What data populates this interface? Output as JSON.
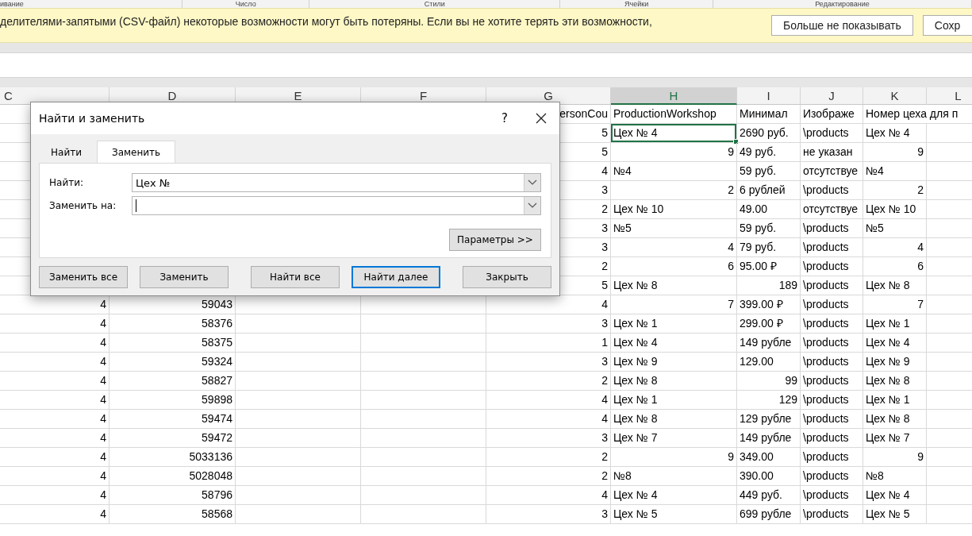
{
  "ribbon_groups": [
    "ивание",
    "Число",
    "Стили",
    "Ячейки",
    "Редактирование"
  ],
  "message_bar": {
    "text": "делителями-запятыми (CSV-файл) некоторые возможности могут быть потеряны. Если вы не хотите терять эти возможности,",
    "buttons": [
      "Больше не показывать",
      "Сохр"
    ]
  },
  "table": {
    "columns": [
      {
        "letter": "C",
        "selected": false
      },
      {
        "letter": "D",
        "selected": false
      },
      {
        "letter": "E",
        "selected": false
      },
      {
        "letter": "F",
        "selected": false
      },
      {
        "letter": "G",
        "selected": false
      },
      {
        "letter": "H",
        "selected": true
      },
      {
        "letter": "I",
        "selected": false
      },
      {
        "letter": "J",
        "selected": false
      },
      {
        "letter": "K",
        "selected": false
      },
      {
        "letter": "L",
        "selected": false
      }
    ],
    "rows": [
      {
        "G": "ersonCou",
        "H": "ProductionWorkshop",
        "I": "Минимал",
        "J": "Изображе",
        "K": "Номер цеха для п",
        "selected": false
      },
      {
        "G": "5",
        "H": "Цех № 4",
        "I": "2690 руб.",
        "J": "\\products",
        "K": "Цех № 4",
        "numeric": {
          "H": false,
          "I": false,
          "K": false
        },
        "selected": true
      },
      {
        "G": "5",
        "H": "9",
        "I": "49 руб.",
        "J": "не указан",
        "K": "9",
        "numeric": {
          "H": true,
          "I": false,
          "K": true
        },
        "selected": false
      },
      {
        "G": "4",
        "H": "№4",
        "I": "59 руб.",
        "J": "отсутствуе",
        "K": "№4",
        "numeric": {
          "H": false,
          "I": false,
          "K": false
        },
        "selected": false
      },
      {
        "G": "3",
        "H": "2",
        "I": "6 рублей",
        "J": "\\products",
        "K": "2",
        "numeric": {
          "H": true,
          "I": false,
          "K": true
        },
        "selected": false
      },
      {
        "G": "2",
        "H": "Цех № 10",
        "I": "49.00",
        "J": "отсутствуе",
        "K": "Цех № 10",
        "numeric": {
          "H": false,
          "I": false,
          "K": false
        },
        "selected": false
      },
      {
        "G": "3",
        "H": "№5",
        "I": "59 руб.",
        "J": "\\products",
        "K": "№5",
        "numeric": {
          "H": false,
          "I": false,
          "K": false
        },
        "selected": false
      },
      {
        "G": "3",
        "H": "4",
        "I": "79 руб.",
        "J": "\\products",
        "K": "4",
        "numeric": {
          "H": true,
          "I": false,
          "K": true
        },
        "selected": false
      },
      {
        "G": "2",
        "H": "6",
        "I": "95.00 ₽",
        "J": "\\products",
        "K": "6",
        "numeric": {
          "H": true,
          "I": false,
          "K": true
        },
        "selected": false
      },
      {
        "G": "5",
        "H": "Цех № 8",
        "I": "189",
        "J": "\\products",
        "K": "Цех № 8",
        "numeric": {
          "H": false,
          "I": true,
          "K": false
        },
        "selected": false
      },
      {
        "C": "4",
        "D": "59043",
        "G": "4",
        "H": "7",
        "I": "399.00 ₽",
        "J": "\\products",
        "K": "7",
        "numeric": {
          "H": true,
          "I": false,
          "K": true
        },
        "selected": false
      },
      {
        "C": "4",
        "D": "58376",
        "G": "3",
        "H": "Цех № 1",
        "I": "299.00 ₽",
        "J": "\\products",
        "K": "Цех № 1",
        "numeric": {
          "H": false,
          "I": false,
          "K": false
        },
        "selected": false
      },
      {
        "C": "4",
        "D": "58375",
        "G": "1",
        "H": "Цех № 4",
        "I": "149 рубле",
        "J": "\\products",
        "K": "Цех № 4",
        "numeric": {
          "H": false,
          "I": false,
          "K": false
        },
        "selected": false
      },
      {
        "C": "4",
        "D": "59324",
        "G": "3",
        "H": "Цех № 9",
        "I": "129.00",
        "J": "\\products",
        "K": "Цех № 9",
        "numeric": {
          "H": false,
          "I": false,
          "K": false
        },
        "selected": false
      },
      {
        "C": "4",
        "D": "58827",
        "G": "2",
        "H": "Цех № 8",
        "I": "99",
        "J": "\\products",
        "K": "Цех № 8",
        "numeric": {
          "H": false,
          "I": true,
          "K": false
        },
        "selected": false
      },
      {
        "C": "4",
        "D": "59898",
        "G": "4",
        "H": "Цех № 1",
        "I": "129",
        "J": "\\products",
        "K": "Цех № 1",
        "numeric": {
          "H": false,
          "I": true,
          "K": false
        },
        "selected": false
      },
      {
        "C": "4",
        "D": "59474",
        "G": "4",
        "H": "Цех № 8",
        "I": "129 рубле",
        "J": "\\products",
        "K": "Цех № 8",
        "numeric": {
          "H": false,
          "I": false,
          "K": false
        },
        "selected": false
      },
      {
        "C": "4",
        "D": "59472",
        "G": "3",
        "H": "Цех № 7",
        "I": "149 рубле",
        "J": "\\products",
        "K": "Цех № 7",
        "numeric": {
          "H": false,
          "I": false,
          "K": false
        },
        "selected": false
      },
      {
        "C": "4",
        "D": "5033136",
        "G": "2",
        "H": "9",
        "I": "349.00",
        "J": "\\products",
        "K": "9",
        "numeric": {
          "H": true,
          "I": false,
          "K": true
        },
        "selected": false
      },
      {
        "C": "4",
        "D": "5028048",
        "G": "2",
        "H": "№8",
        "I": "390.00",
        "J": "\\products",
        "K": "№8",
        "numeric": {
          "H": false,
          "I": false,
          "K": false
        },
        "selected": false
      },
      {
        "C": "4",
        "D": "58796",
        "G": "4",
        "H": "Цех № 4",
        "I": "449 руб.",
        "J": "\\products",
        "K": "Цех № 4",
        "numeric": {
          "H": false,
          "I": false,
          "K": false
        },
        "selected": false
      },
      {
        "C": "4",
        "D": "58568",
        "G": "3",
        "H": "Цех № 5",
        "I": "699 рубле",
        "J": "\\products",
        "K": "Цех № 5",
        "numeric": {
          "H": false,
          "I": false,
          "K": false
        },
        "selected": false
      }
    ]
  },
  "dialog": {
    "title": "Найти и заменить",
    "help": "?",
    "tabs": [
      {
        "label": "Найти",
        "selected": false
      },
      {
        "label": "Заменить",
        "selected": true
      }
    ],
    "fields": [
      {
        "label": "Найти:",
        "value": "Цех №",
        "focused": false
      },
      {
        "label": "Заменить на:",
        "focused": true
      }
    ],
    "options_button": "Параметры >>",
    "buttons": [
      {
        "label": "Заменить все",
        "default": false
      },
      {
        "label": "Заменить",
        "default": false
      },
      {
        "label": "Найти все",
        "default": false
      },
      {
        "label": "Найти далее",
        "default": true
      },
      {
        "label": "Закрыть",
        "default": false
      }
    ]
  }
}
